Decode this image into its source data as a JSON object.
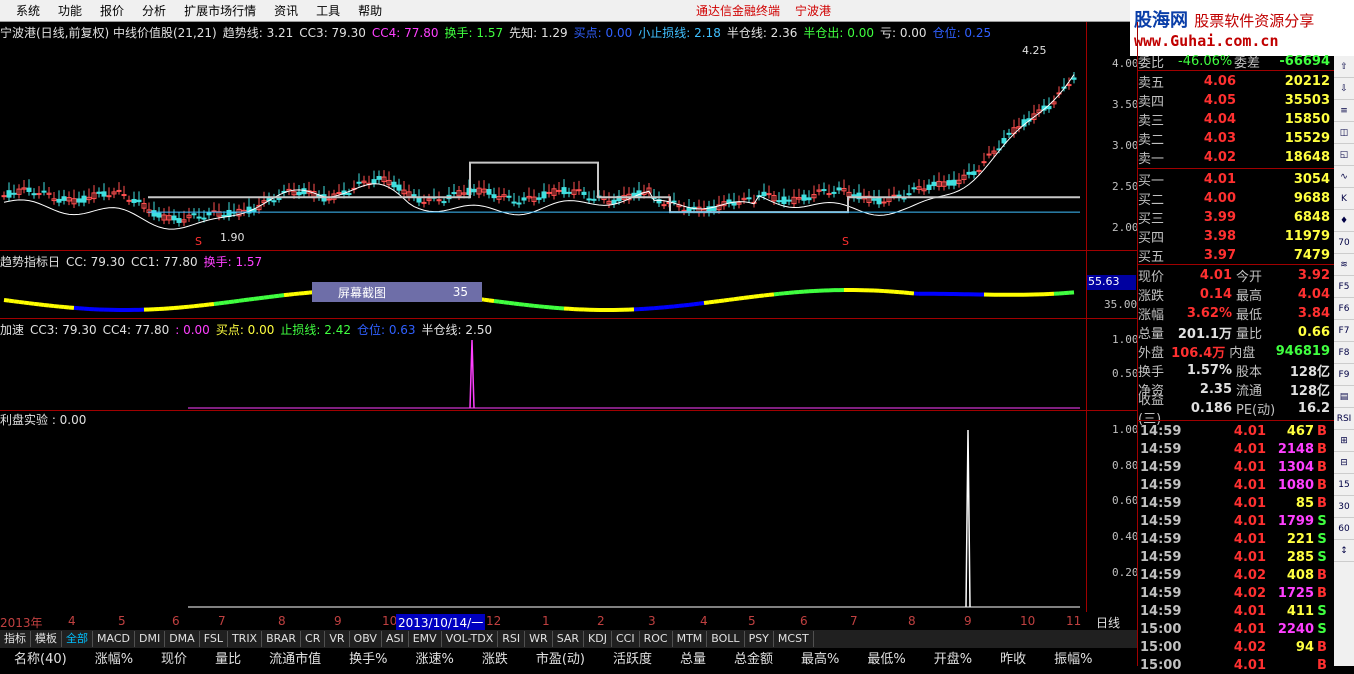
{
  "menu": [
    "系统",
    "功能",
    "报价",
    "分析",
    "扩展市场行情",
    "资讯",
    "工具",
    "帮助"
  ],
  "center_title": "通达信金融终端",
  "center_stock": "宁波港",
  "brand": {
    "main": "股海网",
    "sub": "股票软件资源分享",
    "url": "www.Guhai.com.cn"
  },
  "pane1": {
    "items": [
      {
        "label": "宁波港(日线,前复权) 中线价值股(21,21)",
        "color": "#e0e0e0"
      },
      {
        "label": "趋势线: 3.21",
        "color": "#e0e0e0"
      },
      {
        "label": "CC3: 79.30",
        "color": "#e0e0e0"
      },
      {
        "label": "CC4: 77.80",
        "color": "#ff40ff"
      },
      {
        "label": "换手: 1.57",
        "color": "#40ff40"
      },
      {
        "label": "先知: 1.29",
        "color": "#e0e0e0"
      },
      {
        "label": "买点: 0.00",
        "color": "#3060ff"
      },
      {
        "label": "小止损线: 2.18",
        "color": "#40c0ff"
      },
      {
        "label": "半仓线: 2.36",
        "color": "#e0e0e0"
      },
      {
        "label": "半仓出: 0.00",
        "color": "#40ff40"
      },
      {
        "label": "亏: 0.00",
        "color": "#e0e0e0"
      },
      {
        "label": "仓位: 0.25",
        "color": "#3060ff"
      }
    ],
    "axis": [
      "4.00",
      "3.50",
      "3.00",
      "2.50",
      "2.00"
    ],
    "high_label": "4.25",
    "low_label": "1.90"
  },
  "pane2": {
    "items": [
      {
        "label": "趋势指标日",
        "color": "#e0e0e0"
      },
      {
        "label": "CC: 79.30",
        "color": "#e0e0e0"
      },
      {
        "label": "CC1: 77.80",
        "color": "#e0e0e0"
      },
      {
        "label": "换手: 1.57",
        "color": "#ff40ff"
      }
    ],
    "axis_hl": "55.63",
    "axis": [
      "35.00"
    ],
    "screenshot_btn": "屏幕截图",
    "screenshot_val": "35"
  },
  "pane3": {
    "items": [
      {
        "label": "加速",
        "color": "#e0e0e0"
      },
      {
        "label": "CC3: 79.30",
        "color": "#e0e0e0"
      },
      {
        "label": "CC4: 77.80",
        "color": "#e0e0e0"
      },
      {
        "label": ": 0.00",
        "color": "#ff40ff"
      },
      {
        "label": "买点: 0.00",
        "color": "#ffff40"
      },
      {
        "label": "止损线: 2.42",
        "color": "#40ff40"
      },
      {
        "label": "仓位: 0.63",
        "color": "#3060ff"
      },
      {
        "label": "半仓线: 2.50",
        "color": "#e0e0e0"
      }
    ],
    "axis": [
      "1.00",
      "0.50"
    ]
  },
  "pane4": {
    "items": [
      {
        "label": "利盘实验 : 0.00",
        "color": "#e0e0e0"
      }
    ],
    "axis": [
      "1.00",
      "0.80",
      "0.60",
      "0.40",
      "0.20"
    ]
  },
  "date_axis": {
    "labels": [
      "2013年",
      "4",
      "5",
      "6",
      "7",
      "8",
      "9",
      "10",
      "2013/10/14/一",
      "12",
      "1",
      "2",
      "3",
      "4",
      "5",
      "6",
      "7",
      "8",
      "9",
      "10",
      "11"
    ],
    "day_button": "日线"
  },
  "quote": {
    "ratio": {
      "label": "委比",
      "value": "-46.06%",
      "label2": "委差",
      "value2": "-66694"
    },
    "asks": [
      {
        "label": "卖五",
        "price": "4.06",
        "vol": "20212"
      },
      {
        "label": "卖四",
        "price": "4.05",
        "vol": "35503"
      },
      {
        "label": "卖三",
        "price": "4.04",
        "vol": "15850"
      },
      {
        "label": "卖二",
        "price": "4.03",
        "vol": "15529"
      },
      {
        "label": "卖一",
        "price": "4.02",
        "vol": "18648"
      }
    ],
    "bids": [
      {
        "label": "买一",
        "price": "4.01",
        "vol": "3054"
      },
      {
        "label": "买二",
        "price": "4.00",
        "vol": "9688"
      },
      {
        "label": "买三",
        "price": "3.99",
        "vol": "6848"
      },
      {
        "label": "买四",
        "price": "3.98",
        "vol": "11979"
      },
      {
        "label": "买五",
        "price": "3.97",
        "vol": "7479"
      }
    ],
    "stats": [
      {
        "l1": "现价",
        "v1": "4.01",
        "c1": "#ff3030",
        "l2": "今开",
        "v2": "3.92",
        "c2": "#ff3030"
      },
      {
        "l1": "涨跌",
        "v1": "0.14",
        "c1": "#ff3030",
        "l2": "最高",
        "v2": "4.04",
        "c2": "#ff3030"
      },
      {
        "l1": "涨幅",
        "v1": "3.62%",
        "c1": "#ff3030",
        "l2": "最低",
        "v2": "3.84",
        "c2": "#ff3030"
      },
      {
        "l1": "总量",
        "v1": "201.1万",
        "c1": "#e0e0e0",
        "l2": "量比",
        "v2": "0.66",
        "c2": "#ffff40"
      },
      {
        "l1": "外盘",
        "v1": "106.4万",
        "c1": "#ff3030",
        "l2": "内盘",
        "v2": "946819",
        "c2": "#40ff40"
      },
      {
        "l1": "换手",
        "v1": "1.57%",
        "c1": "#e0e0e0",
        "l2": "股本",
        "v2": "128亿",
        "c2": "#e0e0e0"
      },
      {
        "l1": "净资",
        "v1": "2.35",
        "c1": "#e0e0e0",
        "l2": "流通",
        "v2": "128亿",
        "c2": "#e0e0e0"
      },
      {
        "l1": "收益(三)",
        "v1": "0.186",
        "c1": "#e0e0e0",
        "l2": "PE(动)",
        "v2": "16.2",
        "c2": "#e0e0e0"
      }
    ],
    "ticks": [
      {
        "t": "14:59",
        "p": "4.01",
        "v": "467",
        "vc": "#ffff40",
        "bs": "B"
      },
      {
        "t": "14:59",
        "p": "4.01",
        "v": "2148",
        "vc": "#ff40ff",
        "bs": "B"
      },
      {
        "t": "14:59",
        "p": "4.01",
        "v": "1304",
        "vc": "#ff40ff",
        "bs": "B"
      },
      {
        "t": "14:59",
        "p": "4.01",
        "v": "1080",
        "vc": "#ff40ff",
        "bs": "B"
      },
      {
        "t": "14:59",
        "p": "4.01",
        "v": "85",
        "vc": "#ffff40",
        "bs": "B"
      },
      {
        "t": "14:59",
        "p": "4.01",
        "v": "1799",
        "vc": "#ff40ff",
        "bs": "S"
      },
      {
        "t": "14:59",
        "p": "4.01",
        "v": "221",
        "vc": "#ffff40",
        "bs": "S"
      },
      {
        "t": "14:59",
        "p": "4.01",
        "v": "285",
        "vc": "#ffff40",
        "bs": "S"
      },
      {
        "t": "14:59",
        "p": "4.02",
        "v": "408",
        "vc": "#ffff40",
        "bs": "B"
      },
      {
        "t": "14:59",
        "p": "4.02",
        "v": "1725",
        "vc": "#ff40ff",
        "bs": "B"
      },
      {
        "t": "14:59",
        "p": "4.01",
        "v": "411",
        "vc": "#ffff40",
        "bs": "S"
      },
      {
        "t": "15:00",
        "p": "4.01",
        "v": "2240",
        "vc": "#ff40ff",
        "bs": "S"
      },
      {
        "t": "15:00",
        "p": "4.02",
        "v": "94",
        "vc": "#ffff40",
        "bs": "B"
      },
      {
        "t": "15:00",
        "p": "4.01",
        "v": "",
        "vc": "#ffff40",
        "bs": "B"
      }
    ]
  },
  "sidebar": [
    "⇧",
    "⇩",
    "≡",
    "◫",
    "◱",
    "∿",
    "K",
    "♦",
    "70",
    "≋",
    "F5",
    "F6",
    "F7",
    "F8",
    "F9",
    "▤",
    "RSI",
    "⊞",
    "⊟",
    "15",
    "30",
    "60",
    "↕"
  ],
  "tabs": [
    "指标",
    "模板",
    "全部",
    "MACD",
    "DMI",
    "DMA",
    "FSL",
    "TRIX",
    "BRAR",
    "CR",
    "VR",
    "OBV",
    "ASI",
    "EMV",
    "VOL-TDX",
    "RSI",
    "WR",
    "SAR",
    "KDJ",
    "CCI",
    "ROC",
    "MTM",
    "BOLL",
    "PSY",
    "MCST"
  ],
  "active_tab": "全部",
  "columns": [
    "名称(40)",
    "涨幅%",
    "现价",
    "量比",
    "流通市值",
    "换手%",
    "涨速%",
    "涨跌",
    "市盈(动)",
    "活跃度",
    "总量",
    "总金额",
    "最高%",
    "最低%",
    "开盘%",
    "昨收",
    "振幅%"
  ]
}
